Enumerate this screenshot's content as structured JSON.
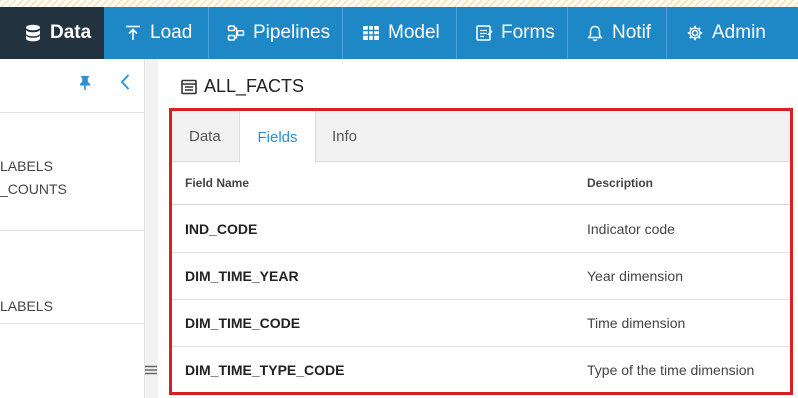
{
  "nav": {
    "items": [
      {
        "label": "Data",
        "icon": "database-icon"
      },
      {
        "label": "Load",
        "icon": "upload-icon"
      },
      {
        "label": "Pipelines",
        "icon": "pipelines-icon"
      },
      {
        "label": "Model",
        "icon": "model-icon"
      },
      {
        "label": "Forms",
        "icon": "forms-icon"
      },
      {
        "label": "Notif",
        "icon": "bell-icon"
      },
      {
        "label": "Admin",
        "icon": "gear-icon"
      }
    ],
    "active": "Data",
    "colors": {
      "bar": "#1e88c7",
      "active": "#23323f"
    }
  },
  "left_panel": {
    "items": [
      "LABELS",
      "_COUNTS",
      "LABELS"
    ]
  },
  "main": {
    "title": "ALL_FACTS",
    "tabs": [
      {
        "label": "Data"
      },
      {
        "label": "Fields"
      },
      {
        "label": "Info"
      }
    ],
    "active_tab": "Fields",
    "table": {
      "headers": {
        "name": "Field Name",
        "description": "Description"
      },
      "rows": [
        {
          "name": "IND_CODE",
          "description": "Indicator code"
        },
        {
          "name": "DIM_TIME_YEAR",
          "description": "Year dimension"
        },
        {
          "name": "DIM_TIME_CODE",
          "description": "Time dimension"
        },
        {
          "name": "DIM_TIME_TYPE_CODE",
          "description": "Type of the time dimension"
        }
      ]
    },
    "highlight_color": "#d91f26"
  }
}
